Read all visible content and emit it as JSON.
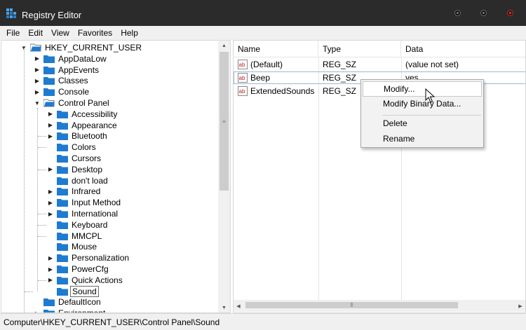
{
  "window": {
    "title": "Registry Editor"
  },
  "menu": [
    "File",
    "Edit",
    "View",
    "Favorites",
    "Help"
  ],
  "tree": {
    "root": "HKEY_CURRENT_USER",
    "items": [
      "AppDataLow",
      "AppEvents",
      "Classes",
      "Console",
      "Control Panel",
      "Accessibility",
      "Appearance",
      "Bluetooth",
      "Colors",
      "Cursors",
      "Desktop",
      "don't load",
      "Infrared",
      "Input Method",
      "International",
      "Keyboard",
      "MMCPL",
      "Mouse",
      "Personalization",
      "PowerCfg",
      "Quick Actions",
      "Sound",
      "DefaultIcon",
      "Environment"
    ],
    "selected": "Sound"
  },
  "list": {
    "columns": [
      "Name",
      "Type",
      "Data"
    ],
    "rows": [
      {
        "name": "(Default)",
        "type": "REG_SZ",
        "data": "(value not set)"
      },
      {
        "name": "Beep",
        "type": "REG_SZ",
        "data": "yes"
      },
      {
        "name": "ExtendedSounds",
        "type": "REG_SZ",
        "data": ""
      }
    ]
  },
  "context_menu": {
    "items": [
      "Modify...",
      "Modify Binary Data...",
      "Delete",
      "Rename"
    ],
    "highlighted": "Modify..."
  },
  "status": {
    "path": "Computer\\HKEY_CURRENT_USER\\Control Panel\\Sound"
  },
  "colors": {
    "titlebar": "#2b2b2b",
    "folder": "#1e7bd0",
    "close_dot": "#d6453c"
  }
}
